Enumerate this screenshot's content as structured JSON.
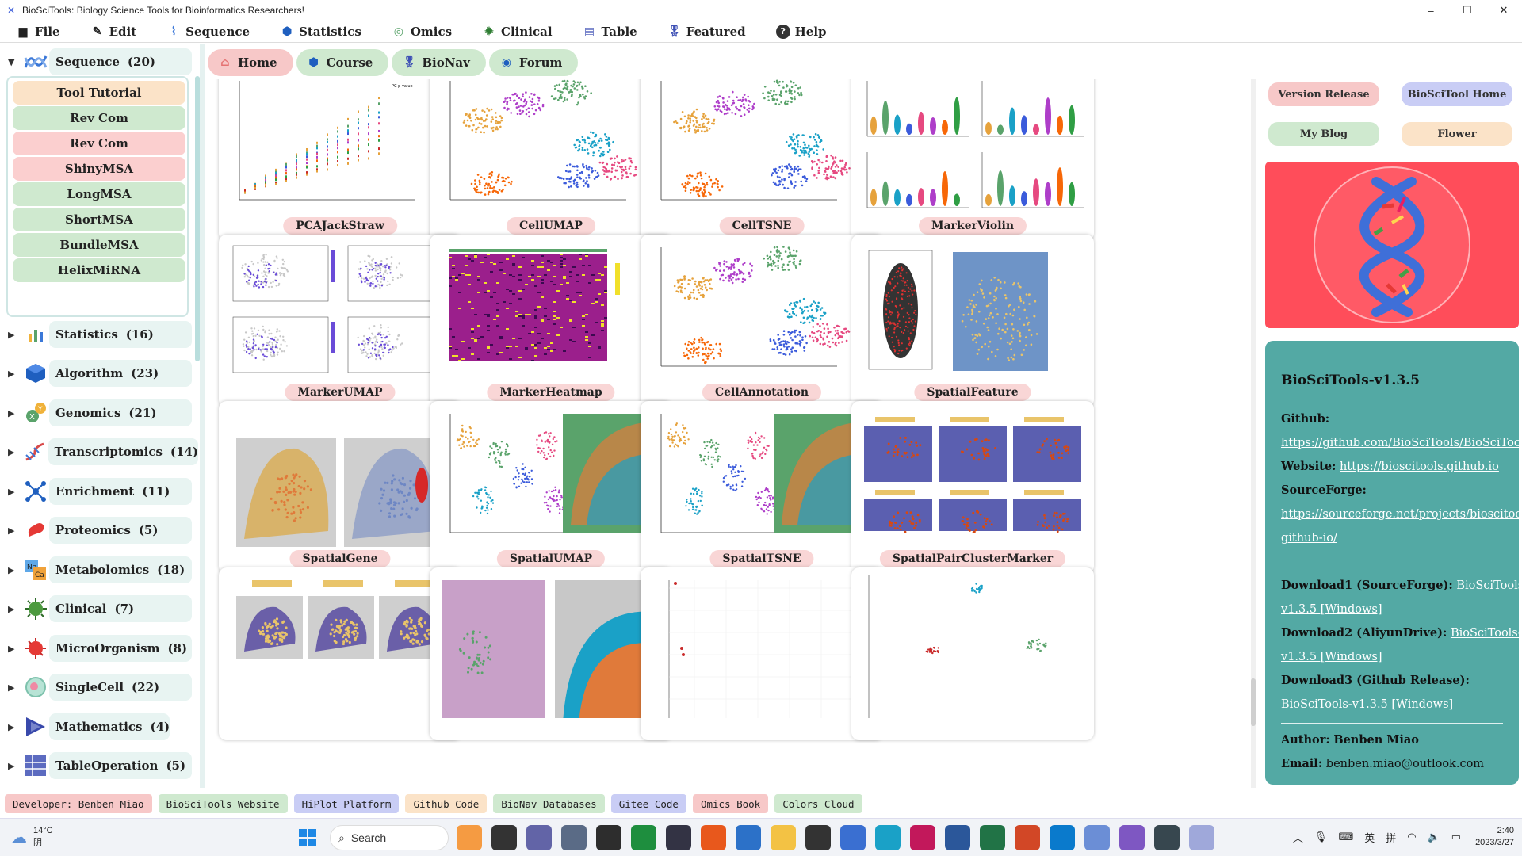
{
  "window": {
    "title": "BioSciTools: Biology Science Tools for Bioinformatics Researchers!",
    "controls": [
      "–",
      "☐",
      "✕"
    ]
  },
  "menu": [
    {
      "label": "File",
      "icon": "file-icon"
    },
    {
      "label": "Edit",
      "icon": "edit-icon"
    },
    {
      "label": "Sequence",
      "icon": "sequence-icon"
    },
    {
      "label": "Statistics",
      "icon": "statistics-icon"
    },
    {
      "label": "Omics",
      "icon": "omics-icon"
    },
    {
      "label": "Clinical",
      "icon": "clinical-icon"
    },
    {
      "label": "Table",
      "icon": "table-icon"
    },
    {
      "label": "Featured",
      "icon": "medal-icon"
    },
    {
      "label": "Help",
      "icon": "help-icon"
    }
  ],
  "sidebar": {
    "categories": [
      {
        "label": "Sequence",
        "count": "(20)",
        "expanded": true
      },
      {
        "label": "Statistics",
        "count": "(16)"
      },
      {
        "label": "Algorithm",
        "count": "(23)"
      },
      {
        "label": "Genomics",
        "count": "(21)"
      },
      {
        "label": "Transcriptomics",
        "count": "(14)"
      },
      {
        "label": "Enrichment",
        "count": "(11)"
      },
      {
        "label": "Proteomics",
        "count": "(5)"
      },
      {
        "label": "Metabolomics",
        "count": "(18)"
      },
      {
        "label": "Clinical",
        "count": "(7)"
      },
      {
        "label": "MicroOrganism",
        "count": "(8)"
      },
      {
        "label": "SingleCell",
        "count": "(22)"
      },
      {
        "label": "Mathematics",
        "count": "(4)"
      },
      {
        "label": "TableOperation",
        "count": "(5)"
      }
    ],
    "sequence_tools": [
      {
        "label": "Tool Tutorial",
        "color": "#fbe3c8"
      },
      {
        "label": "Rev Com",
        "color": "#cfe9cf"
      },
      {
        "label": "Rev Com",
        "color": "#fbcfcf"
      },
      {
        "label": "ShinyMSA",
        "color": "#fbcfcf"
      },
      {
        "label": "LongMSA",
        "color": "#cfe9cf"
      },
      {
        "label": "ShortMSA",
        "color": "#cfe9cf"
      },
      {
        "label": "BundleMSA",
        "color": "#cfe9cf"
      },
      {
        "label": "HelixMiRNA",
        "color": "#cfe9cf"
      }
    ]
  },
  "nav_tabs": [
    {
      "label": "Home",
      "color": "#f7c8c8",
      "icon": "home-icon"
    },
    {
      "label": "Course",
      "color": "#cfe9cf",
      "icon": "course-icon"
    },
    {
      "label": "BioNav",
      "color": "#cfe9cf",
      "icon": "bionav-icon"
    },
    {
      "label": "Forum",
      "color": "#cfe9cf",
      "icon": "forum-icon"
    }
  ],
  "gallery": [
    {
      "label": "PCAJackStraw",
      "thumb": "scatter-lines"
    },
    {
      "label": "CellUMAP",
      "thumb": "clusters"
    },
    {
      "label": "CellTSNE",
      "thumb": "clusters"
    },
    {
      "label": "MarkerViolin",
      "thumb": "violin"
    },
    {
      "label": "MarkerUMAP",
      "thumb": "feature"
    },
    {
      "label": "MarkerHeatmap",
      "thumb": "heatmap"
    },
    {
      "label": "CellAnnotation",
      "thumb": "clusters"
    },
    {
      "label": "SpatialFeature",
      "thumb": "spatial-violin"
    },
    {
      "label": "SpatialGene",
      "thumb": "spatial"
    },
    {
      "label": "SpatialUMAP",
      "thumb": "spatial-umap"
    },
    {
      "label": "SpatialTSNE",
      "thumb": "spatial-umap"
    },
    {
      "label": "SpatialPairClusterMarker",
      "thumb": "spatial-grid"
    },
    {
      "label": "",
      "thumb": "spatial-three"
    },
    {
      "label": "",
      "thumb": "spatial-two"
    },
    {
      "label": "",
      "thumb": "sparse"
    },
    {
      "label": "",
      "thumb": "sparse-umap"
    }
  ],
  "right_panel": {
    "buttons": [
      {
        "label": "Version Release",
        "color": "#f7c8c8"
      },
      {
        "label": "BioSciTool Home",
        "color": "#c9cdf5"
      },
      {
        "label": "My Blog",
        "color": "#cfe9cf"
      },
      {
        "label": "Flower",
        "color": "#fbe3c8"
      }
    ],
    "info": {
      "title": "BioSciTools-v1.3.5",
      "github_label": "Github:",
      "github_url": "https://github.com/BioSciTools/BioSciTools.g",
      "website_label": "Website:",
      "website_url": "https://bioscitools.github.io",
      "sourceforge_label": "SourceForge:",
      "sourceforge_url_1": "https://sourceforge.net/projects/bioscitools-",
      "sourceforge_url_2": "github-io/",
      "download1_label": "Download1 (SourceForge):",
      "download1_link_1": "BioSciTools-",
      "download1_link_2": "v1.3.5 [Windows]",
      "download2_label": "Download2 (AliyunDrive):",
      "download2_link_1": "BioSciTools-",
      "download2_link_2": "v1.3.5 [Windows]",
      "download3_label": "Download3 (Github Release):",
      "download3_link": "BioSciTools-v1.3.5 [Windows]",
      "author_label": "Author:",
      "author": "Benben Miao",
      "email_label": "Email:",
      "email": "benben.miao@outlook.com"
    }
  },
  "bottom_links": [
    {
      "label": "Developer: Benben Miao",
      "color": "#f7c8c8"
    },
    {
      "label": "BioSciTools Website",
      "color": "#cfe9cf"
    },
    {
      "label": "HiPlot Platform",
      "color": "#c9cdf5"
    },
    {
      "label": "Github Code",
      "color": "#fbe3c8"
    },
    {
      "label": "BioNav Databases",
      "color": "#cfe9cf"
    },
    {
      "label": "Gitee Code",
      "color": "#c9cdf5"
    },
    {
      "label": "Omics Book",
      "color": "#f7c8c8"
    },
    {
      "label": "Colors Cloud",
      "color": "#cfe9cf"
    }
  ],
  "taskbar": {
    "weather_temp": "14°C",
    "weather_desc": "阴",
    "search_label": "Search",
    "ime_1": "英",
    "ime_2": "拼",
    "time": "2:40",
    "date": "2023/3/27",
    "apps": [
      {
        "icon": "photos-icon",
        "color": "#f59b42"
      },
      {
        "icon": "task-view-icon",
        "color": "#333333"
      },
      {
        "icon": "teams-icon",
        "color": "#6264a7"
      },
      {
        "icon": "settings-icon",
        "color": "#5a6b86"
      },
      {
        "icon": "terminal-icon",
        "color": "#2d2d2d"
      },
      {
        "icon": "sheets-icon",
        "color": "#1e8e3e"
      },
      {
        "icon": "obs-icon",
        "color": "#333344"
      },
      {
        "icon": "office-icon",
        "color": "#e8581c"
      },
      {
        "icon": "mail-icon",
        "color": "#2c71c8"
      },
      {
        "icon": "folder-icon",
        "color": "#f3c244"
      },
      {
        "icon": "sticky-notes-icon",
        "color": "#333333"
      },
      {
        "icon": "store-icon",
        "color": "#3a6fd1"
      },
      {
        "icon": "edge-icon",
        "color": "#1aa1c7"
      },
      {
        "icon": "app-red-icon",
        "color": "#c2185b"
      },
      {
        "icon": "word-icon",
        "color": "#2b579a"
      },
      {
        "icon": "excel-icon",
        "color": "#217346"
      },
      {
        "icon": "powerpoint-icon",
        "color": "#d24726"
      },
      {
        "icon": "vscode-icon",
        "color": "#0a7acc"
      },
      {
        "icon": "r-icon",
        "color": "#6b8ed6"
      },
      {
        "icon": "visual-studio-icon",
        "color": "#7e57c2"
      },
      {
        "icon": "globe-icon",
        "color": "#37474f"
      },
      {
        "icon": "bioscitools-icon",
        "color": "#9fa8da"
      }
    ]
  }
}
